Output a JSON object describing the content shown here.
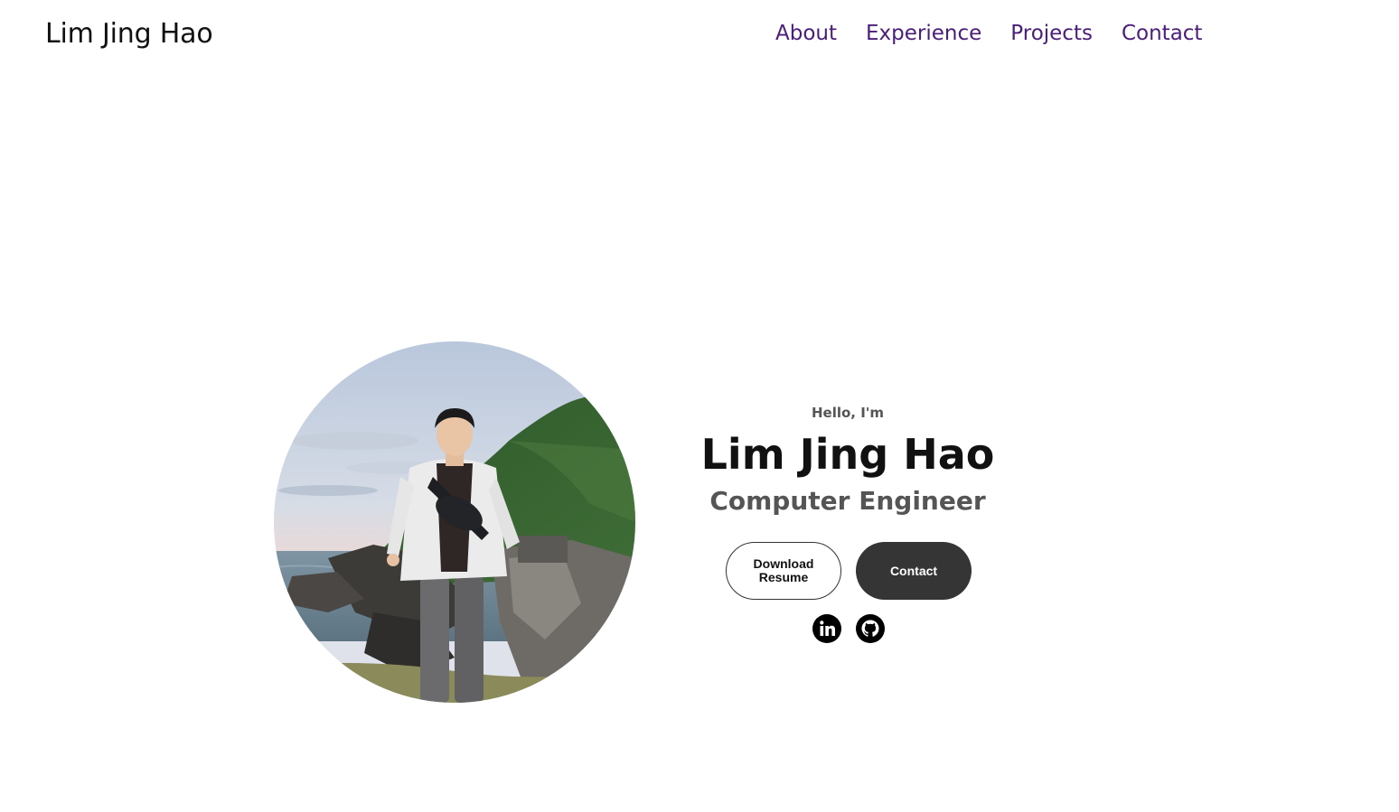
{
  "header": {
    "logo": "Lim Jing Hao",
    "nav": [
      "About",
      "Experience",
      "Projects",
      "Contact"
    ]
  },
  "hero": {
    "greeting": "Hello, I'm",
    "name": "Lim Jing Hao",
    "title": "Computer Engineer",
    "buttons": {
      "resume": "Download Resume",
      "contact": "Contact"
    },
    "socials": [
      {
        "icon": "linkedin-icon"
      },
      {
        "icon": "github-icon"
      }
    ]
  },
  "colors": {
    "nav_link": "#4a1d7a",
    "button_dark": "#353535",
    "subtitle": "#555555"
  }
}
